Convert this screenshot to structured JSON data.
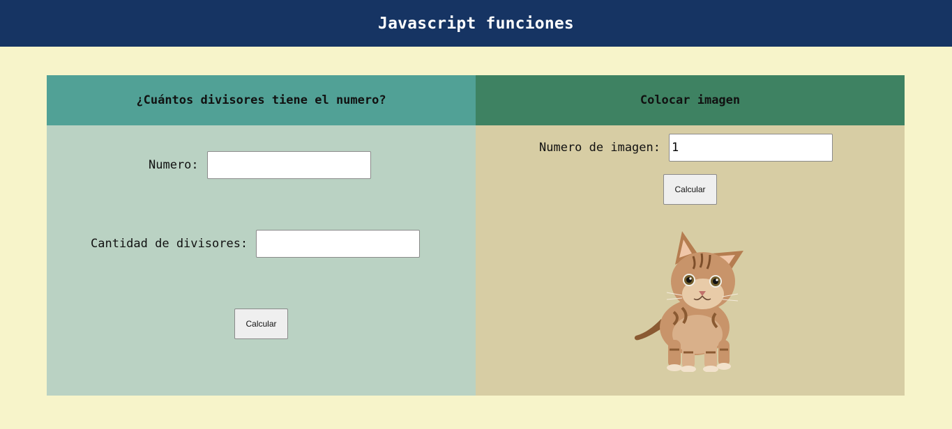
{
  "header": {
    "title": "Javascript funciones"
  },
  "divisores": {
    "title": "¿Cuántos divisores tiene el numero?",
    "numero_label": "Numero:",
    "numero_value": "",
    "cantidad_label": "Cantidad de divisores:",
    "cantidad_value": "",
    "button_label": "Calcular"
  },
  "imagen": {
    "title": "Colocar imagen",
    "numero_label": "Numero de imagen:",
    "numero_value": "1",
    "button_label": "Calcular",
    "image_alt": "kitten"
  },
  "colors": {
    "header_bg": "#163463",
    "page_bg": "#f7f4ca",
    "left_head_bg": "#51a196",
    "left_body_bg": "#bad2c3",
    "right_head_bg": "#3e8262",
    "right_body_bg": "#d7cda4"
  }
}
